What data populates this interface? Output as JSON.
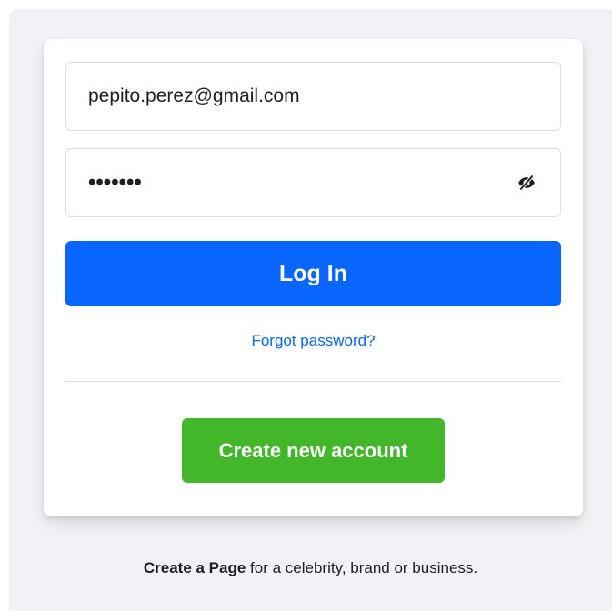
{
  "login_form": {
    "email": {
      "value": "pepito.perez@gmail.com"
    },
    "password": {
      "value": "•••••••",
      "toggle_icon": "eye-slash-icon"
    },
    "login_button_label": "Log In",
    "forgot_password_label": "Forgot password?",
    "create_account_button_label": "Create new account"
  },
  "footer": {
    "create_page_link": "Create a Page",
    "create_page_rest": " for a celebrity, brand or business."
  },
  "colors": {
    "primary": "#0866ff",
    "success": "#42b72a",
    "background": "#f0f2f5",
    "text": "#1c1e21",
    "border": "#dddfe2"
  }
}
